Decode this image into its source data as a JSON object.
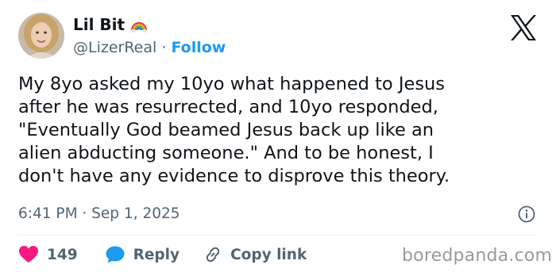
{
  "author": {
    "display_name": "Lil Bit",
    "name_emoji": "rainbow-icon",
    "handle": "@LizerReal",
    "separator": " · ",
    "follow_label": "Follow",
    "avatar": "avatar-photo"
  },
  "header": {
    "logo": "x-logo-icon"
  },
  "tweet": {
    "text": "My 8yo asked my 10yo what happened to Jesus\nafter he was resurrected, and 10yo responded,\n\"Eventually God beamed Jesus back up like an\nalien abducting someone.\" And to be honest, I\ndon't have any evidence to disprove this theory.",
    "timestamp": "6:41 PM · Sep 1, 2025"
  },
  "actions": {
    "like_count": "149",
    "reply_label": "Reply",
    "copy_link_label": "Copy link"
  },
  "watermark": "boredpanda.com",
  "colors": {
    "link_blue": "#1d9bf0",
    "like_pink": "#f91880",
    "muted_gray": "#536471"
  }
}
